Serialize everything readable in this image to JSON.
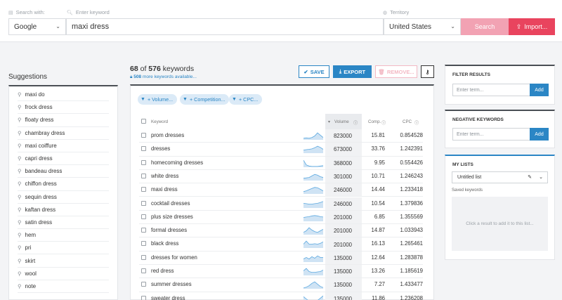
{
  "search": {
    "search_with_label": "Search with:",
    "engine": "Google",
    "keyword_label": "Enter keyword",
    "keyword": "maxi dress",
    "territory_label": "Territory",
    "territory": "United States",
    "search_button": "Search",
    "import_button": "Import..."
  },
  "suggestions": {
    "title": "Suggestions",
    "items": [
      "maxi do",
      "frock dress",
      "floaty dress",
      "chambray dress",
      "maxi coiffure",
      "capri dress",
      "bandeau dress",
      "chiffon dress",
      "sequin dress",
      "kaftan dress",
      "satin dress",
      "hem",
      "pri",
      "skirt",
      "wool",
      "note"
    ]
  },
  "results": {
    "shown": "68",
    "of_word": "of",
    "total": "576",
    "unit": "keywords",
    "more_count": "508",
    "more_text": "more keywords available...",
    "save_label": "SAVE",
    "export_label": "EXPORT",
    "remove_label": "REMOVE...",
    "filters": [
      "+ Volume...",
      "+ Competition...",
      "+ CPC..."
    ],
    "columns": {
      "keyword": "Keyword",
      "volume": "Volume",
      "comp": "Comp.",
      "cpc": "CPC"
    },
    "rows": [
      {
        "keyword": "prom dresses",
        "volume": "823000",
        "comp": "15.81",
        "cpc": "0.854528",
        "trend": [
          0.2,
          0.25,
          0.2,
          0.3,
          0.5,
          0.9,
          0.6,
          0.3
        ]
      },
      {
        "keyword": "dresses",
        "volume": "673000",
        "comp": "33.76",
        "cpc": "1.242391",
        "trend": [
          0.4,
          0.45,
          0.5,
          0.55,
          0.7,
          0.9,
          0.75,
          0.5
        ]
      },
      {
        "keyword": "homecoming dresses",
        "volume": "368000",
        "comp": "9.95",
        "cpc": "0.554426",
        "trend": [
          0.9,
          0.3,
          0.15,
          0.1,
          0.1,
          0.1,
          0.15,
          0.2
        ]
      },
      {
        "keyword": "white dress",
        "volume": "301000",
        "comp": "10.71",
        "cpc": "1.246243",
        "trend": [
          0.3,
          0.35,
          0.4,
          0.6,
          0.8,
          0.7,
          0.5,
          0.4
        ]
      },
      {
        "keyword": "maxi dress",
        "volume": "246000",
        "comp": "14.44",
        "cpc": "1.233418",
        "trend": [
          0.3,
          0.4,
          0.55,
          0.7,
          0.85,
          0.8,
          0.6,
          0.4
        ]
      },
      {
        "keyword": "cocktail dresses",
        "volume": "246000",
        "comp": "10.54",
        "cpc": "1.379836",
        "trend": [
          0.6,
          0.55,
          0.5,
          0.5,
          0.55,
          0.6,
          0.7,
          0.85
        ]
      },
      {
        "keyword": "plus size dresses",
        "volume": "201000",
        "comp": "6.85",
        "cpc": "1.355569",
        "trend": [
          0.5,
          0.55,
          0.6,
          0.7,
          0.75,
          0.7,
          0.6,
          0.55
        ]
      },
      {
        "keyword": "formal dresses",
        "volume": "201000",
        "comp": "14.87",
        "cpc": "1.033943",
        "trend": [
          0.3,
          0.5,
          0.9,
          0.6,
          0.4,
          0.3,
          0.5,
          0.7
        ]
      },
      {
        "keyword": "black dress",
        "volume": "201000",
        "comp": "16.13",
        "cpc": "1.265461",
        "trend": [
          0.5,
          0.9,
          0.5,
          0.5,
          0.55,
          0.5,
          0.6,
          0.8
        ]
      },
      {
        "keyword": "dresses for women",
        "volume": "135000",
        "comp": "12.64",
        "cpc": "1.283878",
        "trend": [
          0.4,
          0.6,
          0.4,
          0.7,
          0.5,
          0.8,
          0.6,
          0.6
        ]
      },
      {
        "keyword": "red dress",
        "volume": "135000",
        "comp": "13.26",
        "cpc": "1.185619",
        "trend": [
          0.6,
          0.9,
          0.5,
          0.4,
          0.4,
          0.45,
          0.5,
          0.7
        ]
      },
      {
        "keyword": "summer dresses",
        "volume": "135000",
        "comp": "7.27",
        "cpc": "1.433477",
        "trend": [
          0.1,
          0.2,
          0.4,
          0.7,
          0.9,
          0.6,
          0.3,
          0.15
        ]
      },
      {
        "keyword": "sweater dress",
        "volume": "135000",
        "comp": "11.86",
        "cpc": "1.236208",
        "trend": [
          0.8,
          0.5,
          0.2,
          0.1,
          0.1,
          0.3,
          0.6,
          0.9
        ]
      }
    ]
  },
  "sidebar": {
    "filter_title": "FILTER RESULTS",
    "filter_placeholder": "Enter term...",
    "add_label": "Add",
    "negative_title": "NEGATIVE KEYWORDS",
    "negative_placeholder": "Enter term...",
    "lists_title": "MY LISTS",
    "list_name": "Untitled list",
    "saved_label": "Saved keywords",
    "empty_hint": "Click a result to add it to this list..."
  },
  "icons": {
    "search_with": "document-icon",
    "keyword": "search-icon",
    "territory": "globe-icon",
    "import": "upload-icon",
    "save": "check-icon",
    "export": "download-icon",
    "remove": "trash-icon",
    "settings": "key-icon",
    "filter": "funnel-icon",
    "edit": "pencil-icon"
  },
  "colors": {
    "accent": "#2b86c5",
    "import": "#e9445e",
    "search": "#f2a2b3",
    "chip_bg": "#dbeaf7",
    "spark": "#5aa8e0"
  }
}
